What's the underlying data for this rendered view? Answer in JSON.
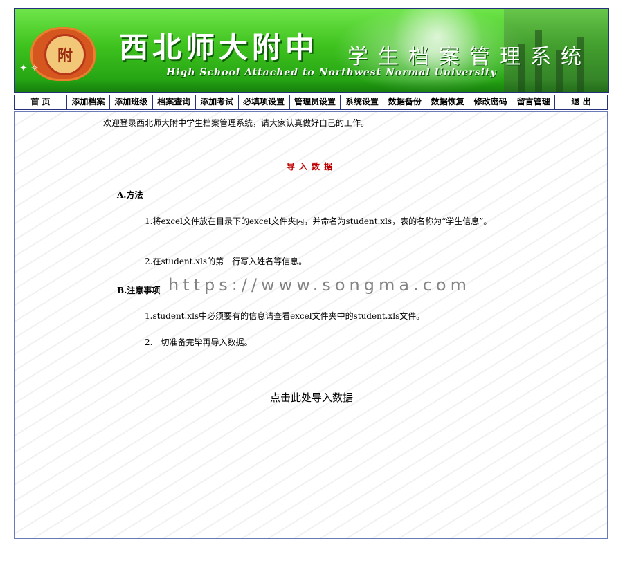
{
  "banner": {
    "title_cn": "西北师大附中",
    "subtitle_cn": "学生档案管理系统",
    "title_en": "High School Attached to Northwest Normal University",
    "emblem_text": "附"
  },
  "nav": {
    "items": [
      {
        "label": "首 页"
      },
      {
        "label": "添加档案"
      },
      {
        "label": "添加班级"
      },
      {
        "label": "档案查询"
      },
      {
        "label": "添加考试"
      },
      {
        "label": "必填项设置"
      },
      {
        "label": "管理员设置"
      },
      {
        "label": "系统设置"
      },
      {
        "label": "数据备份"
      },
      {
        "label": "数据恢复"
      },
      {
        "label": "修改密码"
      },
      {
        "label": "留言管理"
      },
      {
        "label": "退 出"
      }
    ]
  },
  "main": {
    "welcome": "欢迎登录西北师大附中学生档案管理系统，请大家认真做好自己的工作。",
    "section_title": "导入数据",
    "method_heading": "A.方法",
    "method_items": [
      "1.将excel文件放在目录下的excel文件夹内，并命名为student.xls，表的名称为“学生信息”。",
      "2.在student.xls的第一行写入姓名等信息。"
    ],
    "note_heading": "B.注意事项",
    "note_items": [
      "1.student.xls中必须要有的信息请查看excel文件夹中的student.xls文件。",
      "2.一切准备完毕再导入数据。"
    ],
    "import_link": "点击此处导入数据"
  },
  "watermark": "https://www.songma.com",
  "colors": {
    "border": "#25317a",
    "section_title": "#c00000",
    "banner_green": "#3ec21e"
  }
}
